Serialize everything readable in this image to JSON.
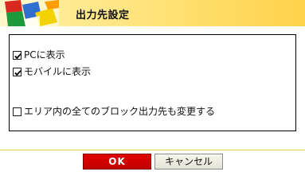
{
  "window": {
    "title": "出力先設定"
  },
  "header": {
    "logo_icon": "colorful-boxes-logo",
    "colors": {
      "gradient_start": "#fff2a8",
      "gradient_end": "#ffd24a"
    }
  },
  "options": [
    {
      "label": "PCに表示",
      "checked": true
    },
    {
      "label": "モバイルに表示",
      "checked": true
    },
    {
      "label": "エリア内の全てのブロック出力先も変更する",
      "checked": false
    }
  ],
  "buttons": {
    "ok_label": "OK",
    "cancel_label": "キャンセル",
    "ok_color": "#d40000"
  }
}
